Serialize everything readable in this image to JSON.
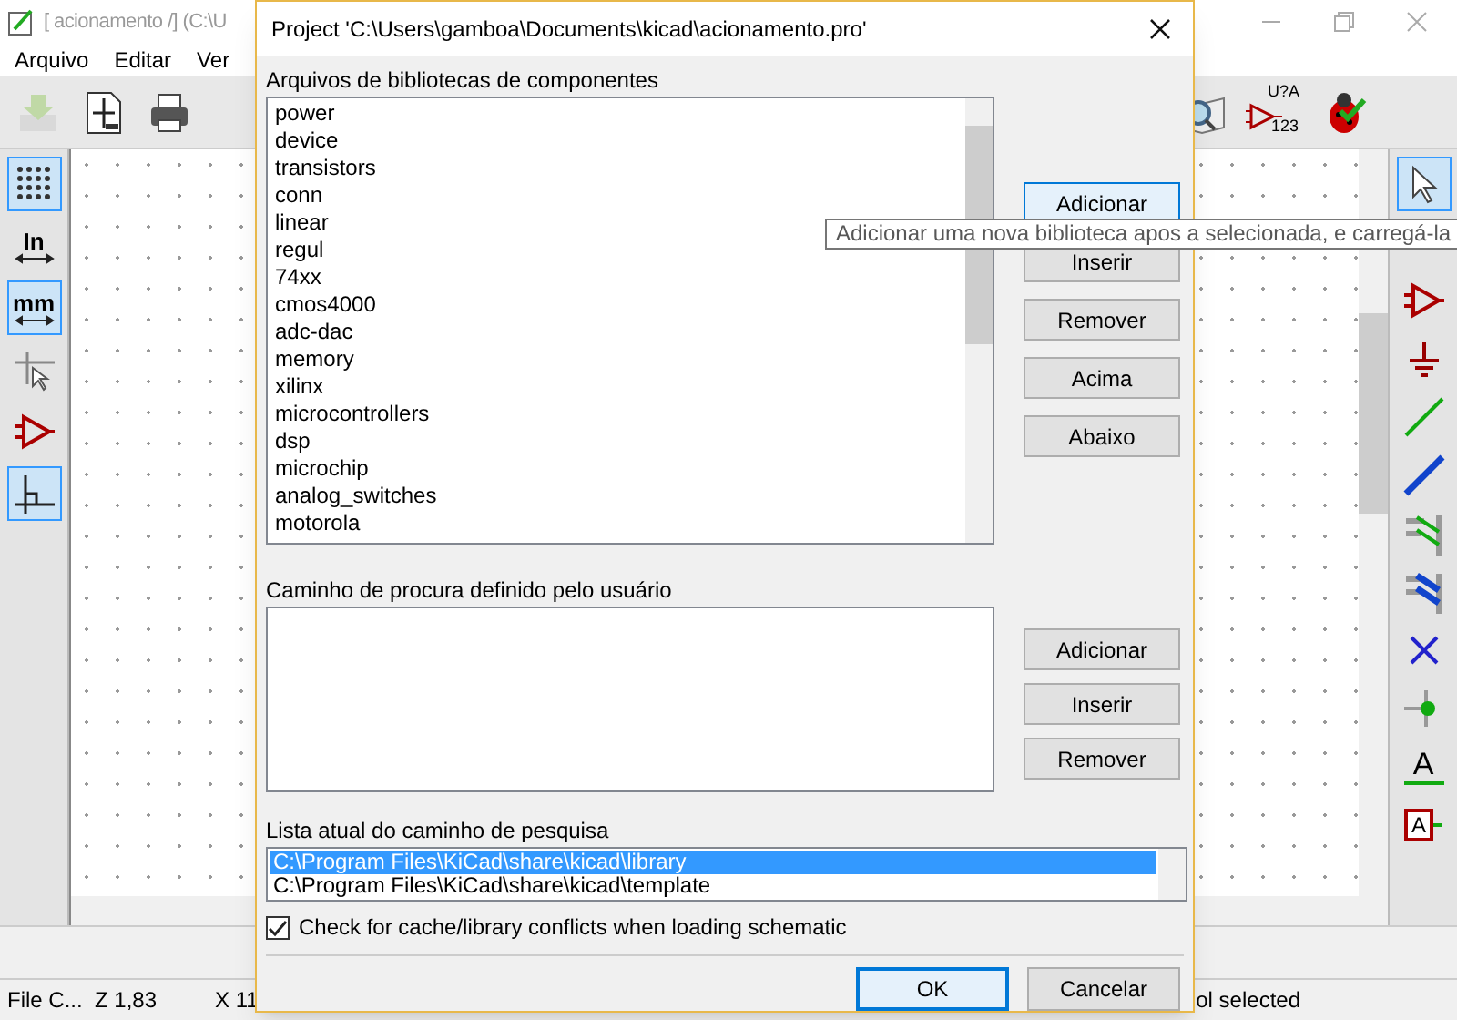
{
  "main_window": {
    "title": "[ acionamento /] (C:\\U",
    "menu": [
      "Arquivo",
      "Editar",
      "Ver"
    ],
    "top_toolbar": [
      {
        "kind": "save",
        "disabled": true
      },
      {
        "kind": "page"
      },
      {
        "kind": "print"
      }
    ],
    "top_toolbar_right": [
      {
        "kind": "library_browser"
      },
      {
        "kind": "annotate",
        "texts": [
          "U?A",
          "123"
        ]
      },
      {
        "kind": "erc"
      }
    ],
    "left_toolbar": [
      {
        "kind": "grid",
        "selected": true
      },
      {
        "kind": "units",
        "label": "In",
        "selected": false
      },
      {
        "kind": "units",
        "label": "mm",
        "selected": true
      },
      {
        "kind": "cursor",
        "selected": false
      },
      {
        "kind": "amp",
        "selected": false
      },
      {
        "kind": "ortho",
        "selected": true
      }
    ],
    "right_toolbar": [
      {
        "kind": "pointer",
        "selected": true
      },
      {
        "kind": "spacer"
      },
      {
        "kind": "component",
        "selected": false
      },
      {
        "kind": "power",
        "selected": false
      },
      {
        "kind": "wire",
        "selected": false
      },
      {
        "kind": "bus",
        "selected": false
      },
      {
        "kind": "wire_entry",
        "selected": false
      },
      {
        "kind": "bus_entry",
        "selected": false
      },
      {
        "kind": "no_connect",
        "selected": false
      },
      {
        "kind": "junction",
        "selected": false
      },
      {
        "kind": "label",
        "label": "A",
        "selected": false
      },
      {
        "kind": "global_label",
        "label": "A",
        "selected": false
      }
    ],
    "status_bar": [
      "File C...",
      "Z 1,83",
      "X 11",
      "ol selected"
    ]
  },
  "dialog": {
    "title": "Project 'C:\\Users\\gamboa\\Documents\\kicad\\acionamento.pro'",
    "libraries": {
      "label": "Arquivos de bibliotecas de componentes",
      "items": [
        "power",
        "device",
        "transistors",
        "conn",
        "linear",
        "regul",
        "74xx",
        "cmos4000",
        "adc-dac",
        "memory",
        "xilinx",
        "microcontrollers",
        "dsp",
        "microchip",
        "analog_switches",
        "motorola"
      ],
      "buttons": [
        {
          "label": "Adicionar",
          "focused": true
        },
        {
          "label": "Inserir",
          "focused": false
        },
        {
          "label": "Remover",
          "focused": false
        },
        {
          "label": "Acima",
          "focused": false
        },
        {
          "label": "Abaixo",
          "focused": false
        }
      ]
    },
    "user_paths": {
      "label": "Caminho de procura definido pelo usuário",
      "buttons": [
        {
          "label": "Adicionar",
          "focused": false
        },
        {
          "label": "Inserir",
          "focused": false
        },
        {
          "label": "Remover",
          "focused": false
        }
      ]
    },
    "search_list": {
      "label": "Lista atual do caminho de pesquisa",
      "items": [
        {
          "text": "C:\\Program Files\\KiCad\\share\\kicad\\library",
          "selected": true
        },
        {
          "text": "C:\\Program Files\\KiCad\\share\\kicad\\template",
          "selected": false
        }
      ]
    },
    "check": {
      "label": "Check for cache/library conflicts when loading schematic",
      "checked": true
    },
    "ok": {
      "label": "OK",
      "focused": true
    },
    "cancel": {
      "label": "Cancelar",
      "focused": false
    }
  },
  "tooltip": "Adicionar uma nova biblioteca apos a selecionada, e carregá-la"
}
